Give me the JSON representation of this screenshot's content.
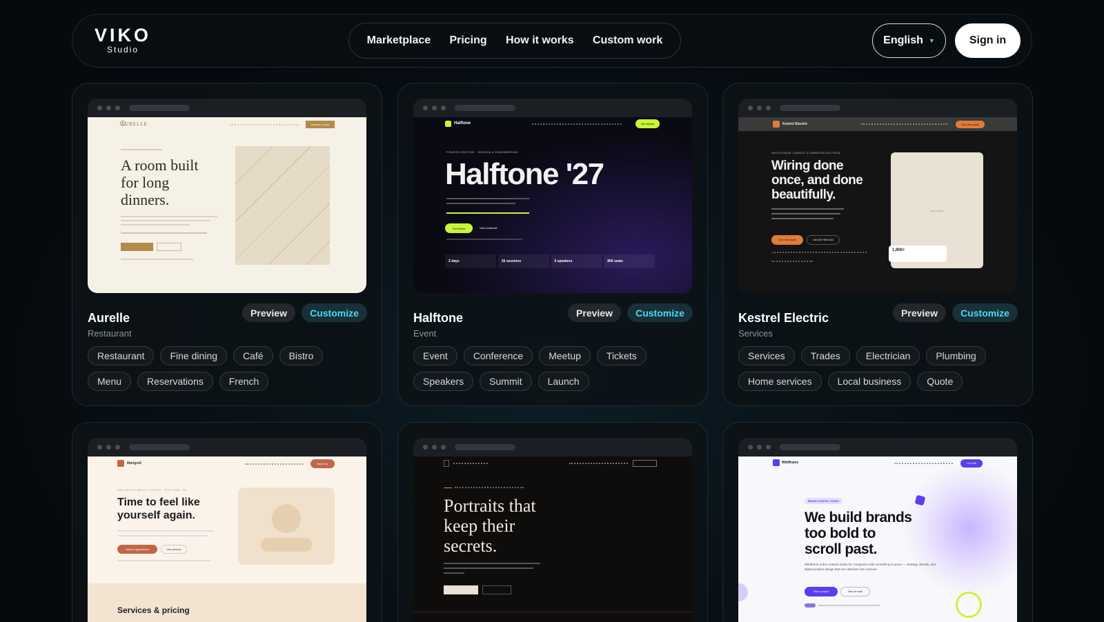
{
  "header": {
    "logo_main": "VIKO",
    "logo_sub": "Studio",
    "menu": [
      "Marketplace",
      "Pricing",
      "How it works",
      "Custom work"
    ],
    "language": "English",
    "sign_in": "Sign in"
  },
  "cards": [
    {
      "title": "Aurelle",
      "category": "Restaurant",
      "preview": "Preview",
      "customize": "Customize",
      "tags": [
        "Restaurant",
        "Fine dining",
        "Café",
        "Bistro",
        "Menu",
        "Reservations",
        "French"
      ],
      "site": {
        "brand": "AURELLE",
        "headline": [
          "A room built",
          "for long",
          "dinners."
        ],
        "cta": "RESERVE A TABLE"
      }
    },
    {
      "title": "Halftone",
      "category": "Event",
      "preview": "Preview",
      "customize": "Customize",
      "tags": [
        "Event",
        "Conference",
        "Meetup",
        "Tickets",
        "Speakers",
        "Summit",
        "Launch"
      ],
      "site": {
        "brand": "Halftone",
        "kicker": "FOURTH EDITION · DESIGN & ENGINEERING",
        "headline": "Halftone '27",
        "cta": "Get tickets",
        "cta2": "View schedule",
        "nav_cta": "Get tickets",
        "stats": [
          "2 days",
          "16 sessions",
          "6 speakers",
          "800 seats"
        ]
      }
    },
    {
      "title": "Kestrel Electric",
      "category": "Services",
      "preview": "Preview",
      "customize": "Customize",
      "tags": [
        "Services",
        "Trades",
        "Electrician",
        "Plumbing",
        "Home services",
        "Local business",
        "Quote"
      ],
      "site": {
        "brand": "Kestrel Electric",
        "kicker": "NORTH LONDON · DOMESTIC & COMMERCIAL ELECTRICAL",
        "headline": [
          "Wiring done",
          "once, and done",
          "beautifully."
        ],
        "cta": "Get a free quote",
        "cta2": "Call 020 7946 0412",
        "badge": "1,900+",
        "photo": "hero photo",
        "nav_cta": "Get a free quote"
      }
    },
    {
      "title": "Marigold",
      "category": "",
      "preview": "",
      "customize": "",
      "tags": [],
      "site": {
        "brand": "Marigold",
        "kicker": "WELLNESS & BEAUTY STUDIO · PORTLAND, OR",
        "headline": [
          "Time to feel like",
          "yourself again."
        ],
        "cta": "Book an appointment",
        "cta2": "View services",
        "nav_cta": "Book now",
        "section": "Services & pricing"
      }
    },
    {
      "title": "",
      "category": "",
      "preview": "",
      "customize": "",
      "tags": [],
      "site": {
        "headline": [
          "Portraits that",
          "keep their",
          "secrets."
        ]
      }
    },
    {
      "title": "Wildframe",
      "category": "",
      "preview": "",
      "customize": "",
      "tags": [],
      "site": {
        "brand": "Wildframe",
        "kicker": "BRAND & DIGITAL STUDIO",
        "headline": [
          "We build brands",
          "too bold to",
          "scroll past."
        ],
        "cta": "Start a project",
        "cta2": "See our work",
        "nav_cta": "Let's talk",
        "body": "Wildframe is the creative studio for companies with something to prove — strategy, identity, and digital product design that turn attention into revenue."
      }
    }
  ]
}
